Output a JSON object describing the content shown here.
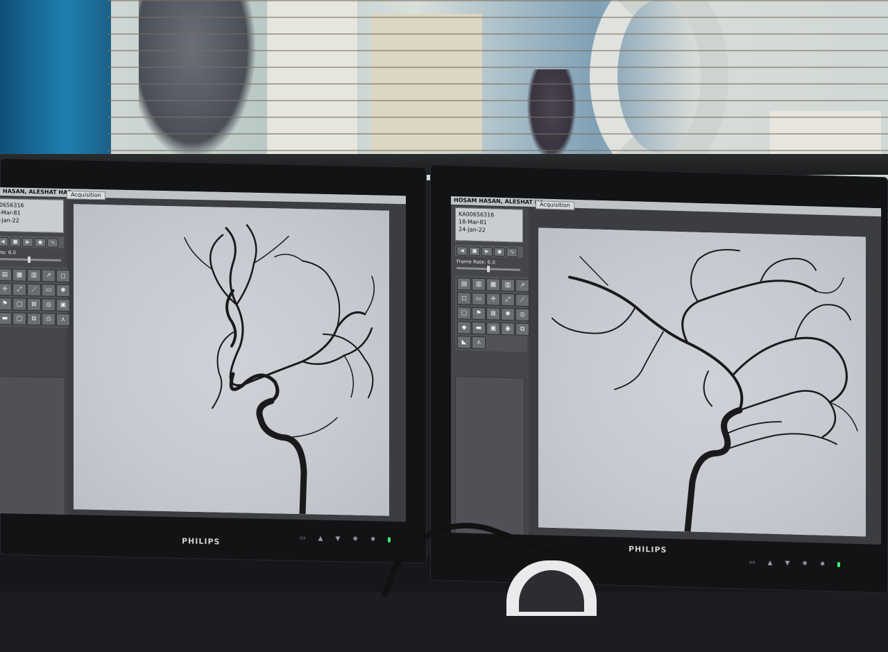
{
  "left_monitor": {
    "patient_name": "HASAN, ALESHAT HAS",
    "tab": "Acquisition",
    "info": [
      "0656316",
      "-Mar-81",
      "-Jan-22"
    ],
    "frame_rate": "ate: 6.0",
    "brand": "PHILIPS"
  },
  "right_monitor": {
    "patient_name": "HOSAM HASAN, ALESHAT HA",
    "tab": "Acquisition",
    "info": [
      "KA00656316",
      "18-Mar-81",
      "24-Jan-22"
    ],
    "frame_rate": "Frame Rate: 6.0",
    "brand": "PHILIPS"
  },
  "icons": {
    "controls": [
      "rewind-icon",
      "stop-icon",
      "play-icon",
      "record-icon",
      "waveform-icon"
    ],
    "tools": [
      "folder-icon",
      "grid-icon",
      "stats-icon",
      "measure-icon",
      "annotate-icon",
      "crosshair-icon",
      "zoom-icon",
      "vessel-icon",
      "window-icon",
      "contrast-icon",
      "flag-icon",
      "overlay-icon",
      "shutter-icon",
      "roi-icon",
      "camera-icon",
      "film-icon",
      "layout-icon",
      "export-icon",
      "print-icon",
      "settings-icon"
    ],
    "bezel": [
      "input-icon",
      "up-icon",
      "down-icon",
      "brightness-icon",
      "menu-icon"
    ]
  },
  "colors": {
    "screen_bg": "#3c3d42",
    "angio_bg": "#c9ccd2",
    "vessel": "#1a1a1c",
    "power_led": "#3dff6a"
  }
}
